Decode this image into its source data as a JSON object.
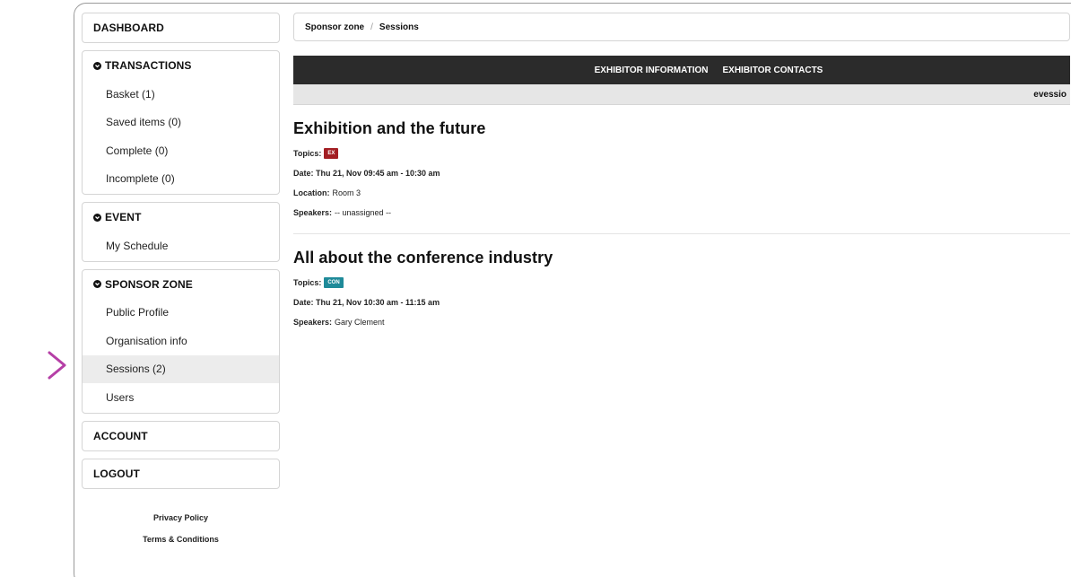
{
  "sidebar": {
    "dashboard": "DASHBOARD",
    "transactions": {
      "title": "TRANSACTIONS",
      "items": [
        "Basket (1)",
        "Saved items (0)",
        "Complete (0)",
        "Incomplete (0)"
      ]
    },
    "event": {
      "title": "EVENT",
      "items": [
        "My Schedule"
      ]
    },
    "sponsor_zone": {
      "title": "SPONSOR ZONE",
      "items": [
        "Public Profile",
        "Organisation info",
        "Sessions (2)",
        "Users"
      ],
      "active_item": "Sessions (2)"
    },
    "account": "ACCOUNT",
    "logout": "LOGOUT",
    "footer": [
      "Privacy Policy",
      "Terms & Conditions"
    ]
  },
  "breadcrumb": {
    "parent": "Sponsor zone",
    "separator": "/",
    "current": "Sessions"
  },
  "navbar": {
    "items": [
      "EXHIBITOR INFORMATION",
      "EXHIBITOR CONTACTS"
    ]
  },
  "subbar": {
    "brand": "evessio"
  },
  "sessions": [
    {
      "title": "Exhibition and the future",
      "topics_label": "Topics:",
      "topic_tag": "EX",
      "topic_color": "#a31f24",
      "date": "Date: Thu 21, Nov 09:45 am - 10:30 am",
      "location_label": "Location:",
      "location": "Room 3",
      "speakers_label": "Speakers:",
      "speakers": "-- unassigned --"
    },
    {
      "title": "All about the conference industry",
      "topics_label": "Topics:",
      "topic_tag": "CON",
      "topic_color": "#1f8a99",
      "date": "Date: Thu 21, Nov 10:30 am - 11:15 am",
      "speakers_label": "Speakers:",
      "speakers": "Gary Clement"
    }
  ],
  "colors": {
    "navbar_bg": "#2b2b2b",
    "active_item_bg": "#ececec",
    "arrow_start": "#f08a3c",
    "arrow_end": "#b53fa6"
  },
  "icons": {
    "section_caret": "chevron-down-circle-icon",
    "pointer": "arrow-right-icon"
  }
}
